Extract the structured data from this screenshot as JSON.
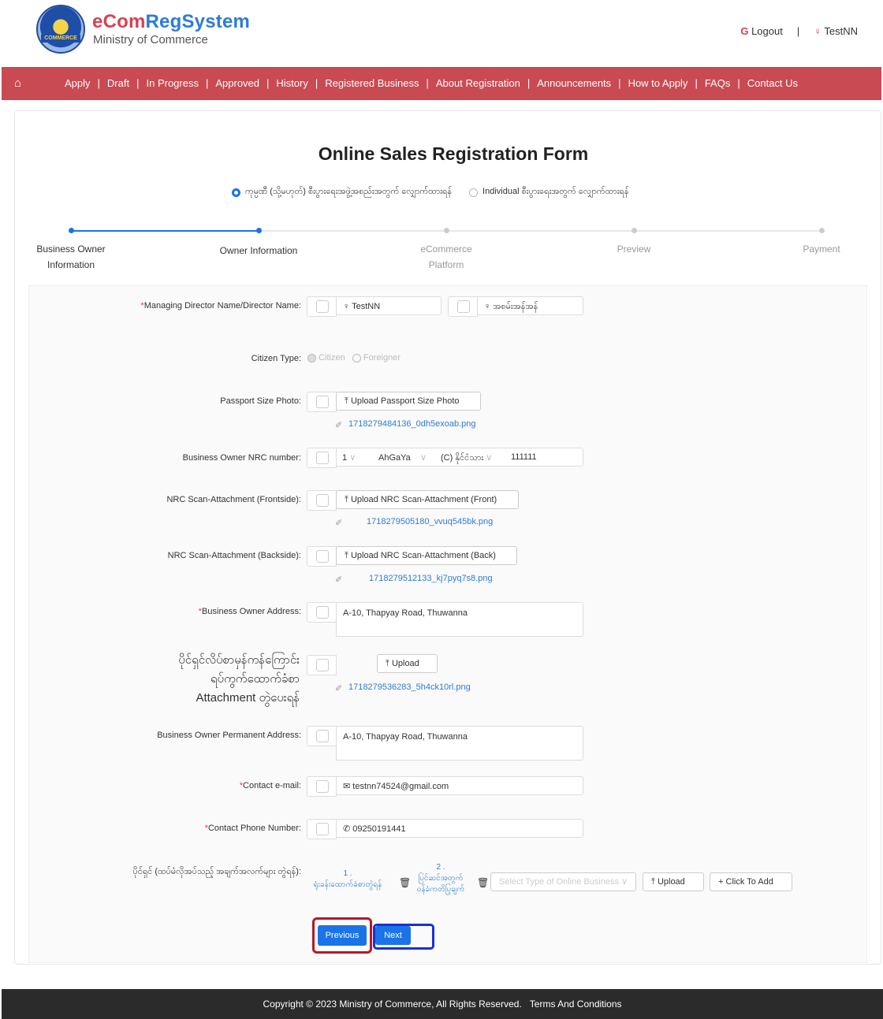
{
  "header": {
    "brand_e": "e",
    "brand_com": "Com",
    "brand_reg": "Reg",
    "brand_system": "System",
    "ministry": "Ministry of Commerce",
    "logo_text": "COMMERCE",
    "logout": "Logout",
    "user": "TestNN",
    "separator": "|"
  },
  "nav": {
    "items": [
      "Apply",
      "Draft",
      "In Progress",
      "Approved",
      "History",
      "Registered Business",
      "About Registration",
      "Announcements",
      "How to Apply",
      "FAQs",
      "Contact Us"
    ],
    "separator": "|"
  },
  "form": {
    "title": "Online Sales Registration Form",
    "radio_company": "ကုမ္ပဏီ (သို့မဟုတ်) စီးပွားရေးအဖွဲ့အစည်းအတွက် လျှောက်ထားရန်",
    "radio_individual": "Individual စီးပွားရေးအတွက် လျှောက်ထားရန်"
  },
  "steps": [
    {
      "label_1": "Business Owner",
      "label_2": "Information"
    },
    {
      "label_1": "Owner Information",
      "label_2": ""
    },
    {
      "label_1": "eCommerce",
      "label_2": "Platform"
    },
    {
      "label_1": "Preview",
      "label_2": ""
    },
    {
      "label_1": "Payment",
      "label_2": ""
    }
  ],
  "fields": {
    "director_label": "Managing Director Name/Director Name:",
    "director_en": "TestNN",
    "director_mm": "အစမ်းအန်အန်",
    "citizen_label": "Citizen Type:",
    "citizen": "Citizen",
    "foreigner": "Foreigner",
    "photo_label": "Passport Size Photo:",
    "photo_btn": "Upload Passport Size Photo",
    "photo_file": "1718279484136_0dh5exoab.png",
    "nrc_label": "Business Owner NRC number:",
    "nrc_state": "1",
    "nrc_town": "AhGaYa",
    "nrc_type": "(C) နိုင်ငံသား",
    "nrc_no": "111111",
    "nrc_front_label": "NRC Scan-Attachment (Frontside):",
    "nrc_front_btn": "Upload NRC Scan-Attachment (Front)",
    "nrc_front_file": "1718279505180_vvuq545bk.png",
    "nrc_back_label": "NRC Scan-Attachment (Backside):",
    "nrc_back_btn": "Upload NRC Scan-Attachment (Back)",
    "nrc_back_file": "1718279512133_kj7pyq7s8.png",
    "address_label": "Business Owner Address:",
    "address": "A-10, Thapyay Road, Thuwanna",
    "household_label_1": "ပိုင်ရှင်လိပ်စာမှန်ကန်ကြောင်း",
    "household_label_2": "ရပ်ကွက်ထောက်ခံစာ",
    "household_label_3": "Attachment တွဲပေးရန်",
    "household_btn": "Upload",
    "household_file": "1718279536283_5h4ck10rl.png",
    "perm_label": "Business Owner Permanent Address:",
    "perm_address": "A-10, Thapyay Road, Thuwanna",
    "email_label": "Contact e-mail:",
    "email": "testnn74524@gmail.com",
    "phone_label": "Contact Phone Number:",
    "phone": "09250191441",
    "docs_label": "ပိုင်ရှင် (ထပ်မံလိုအပ်သည့် အချက်အလက်များ တွဲရန်):",
    "doc1_num": "1 .",
    "doc1_name": "ရုံးခန်းထောက်ခံစာတွဲရန်",
    "doc2_num": "2 .",
    "doc2_name_1": "ပြင်ဆင်အတွက်",
    "doc2_name_2": "ဝန်ခံကတိပြုချက်",
    "select_type_placeholder": "Select Type of Online Business",
    "upload_btn": "Upload",
    "add_btn": "Click To Add",
    "required_mark": "*"
  },
  "actions": {
    "previous": "Previous",
    "next": "Next"
  },
  "footer": {
    "copyright": "Copyright © 2023 Ministry of Commerce, All Rights Reserved.",
    "terms": "Terms And Conditions"
  },
  "colors": {
    "nav_bg": "#c94a53",
    "accent": "#1a73e8",
    "footer_bg": "#2b2b2b"
  }
}
